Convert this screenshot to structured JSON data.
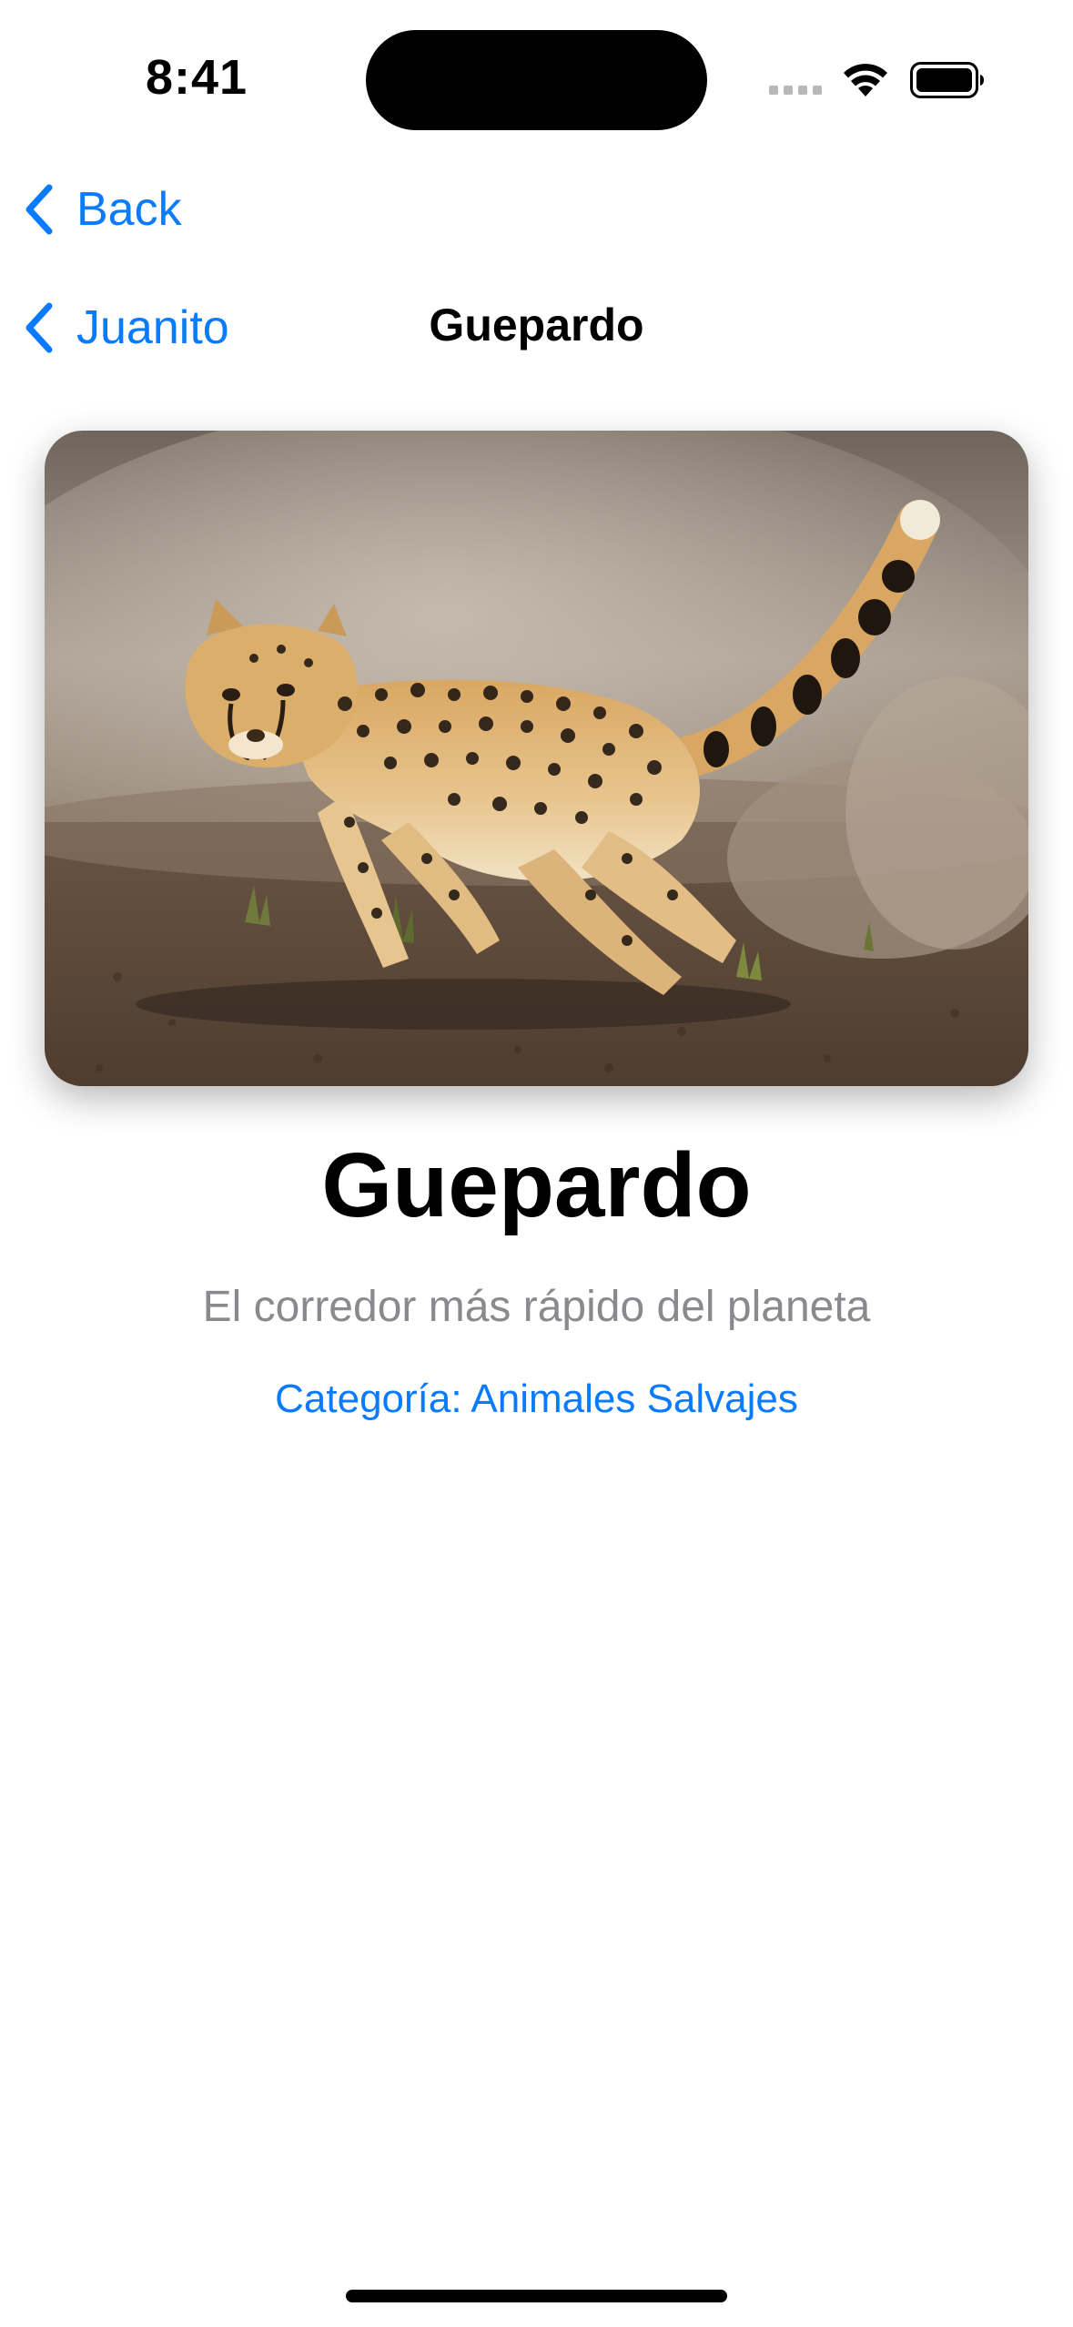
{
  "status_bar": {
    "time": "8:41"
  },
  "navigation": {
    "back_label": "Back",
    "parent_label": "Juanito",
    "title": "Guepardo"
  },
  "detail": {
    "image_subject": "cheetah running",
    "name": "Guepardo",
    "description": "El corredor más rápido del planeta",
    "category": "Categoría: Animales Salvajes"
  },
  "icons": {
    "back": "chevron-left-icon",
    "wifi": "wifi-icon",
    "battery": "battery-icon",
    "signal": "signal-dots-icon"
  },
  "colors": {
    "accent": "#0a7aff",
    "secondary_text": "#8a8a8e",
    "primary_text": "#000000",
    "background": "#ffffff"
  }
}
